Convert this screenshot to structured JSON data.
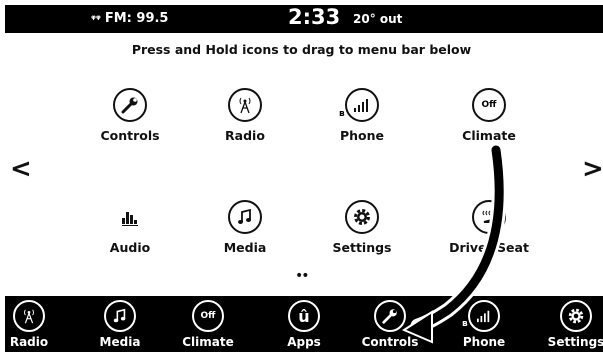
{
  "status": {
    "radio": "FM: 99.5",
    "time": "2:33",
    "temperature": "20° out"
  },
  "instruction": "Press and Hold icons to drag to menu bar below",
  "grid": {
    "row1": [
      {
        "label": "Controls",
        "icon": "wrench-icon"
      },
      {
        "label": "Radio",
        "icon": "radio-tower-icon"
      },
      {
        "label": "Phone",
        "icon": "phone-signal-icon"
      },
      {
        "label": "Climate",
        "icon": "off-icon",
        "icon_text": "Off"
      }
    ],
    "row2": [
      {
        "label": "Audio",
        "icon": "equalizer-icon"
      },
      {
        "label": "Media",
        "icon": "music-note-icon"
      },
      {
        "label": "Settings",
        "icon": "gear-icon"
      },
      {
        "label": "Driver Seat",
        "icon": "heated-seat-icon"
      }
    ]
  },
  "nav": {
    "prev": "<",
    "next": ">"
  },
  "page_indicator": "••",
  "menu_bar": [
    {
      "label": "Radio",
      "icon": "radio-tower-icon"
    },
    {
      "label": "Media",
      "icon": "music-note-icon"
    },
    {
      "label": "Climate",
      "icon": "off-icon",
      "icon_text": "Off"
    },
    {
      "label": "Apps",
      "icon": "apps-icon",
      "icon_text": "û"
    },
    {
      "label": "Controls",
      "icon": "wrench-icon"
    },
    {
      "label": "Phone",
      "icon": "phone-signal-icon"
    },
    {
      "label": "Settings",
      "icon": "gear-icon"
    }
  ]
}
